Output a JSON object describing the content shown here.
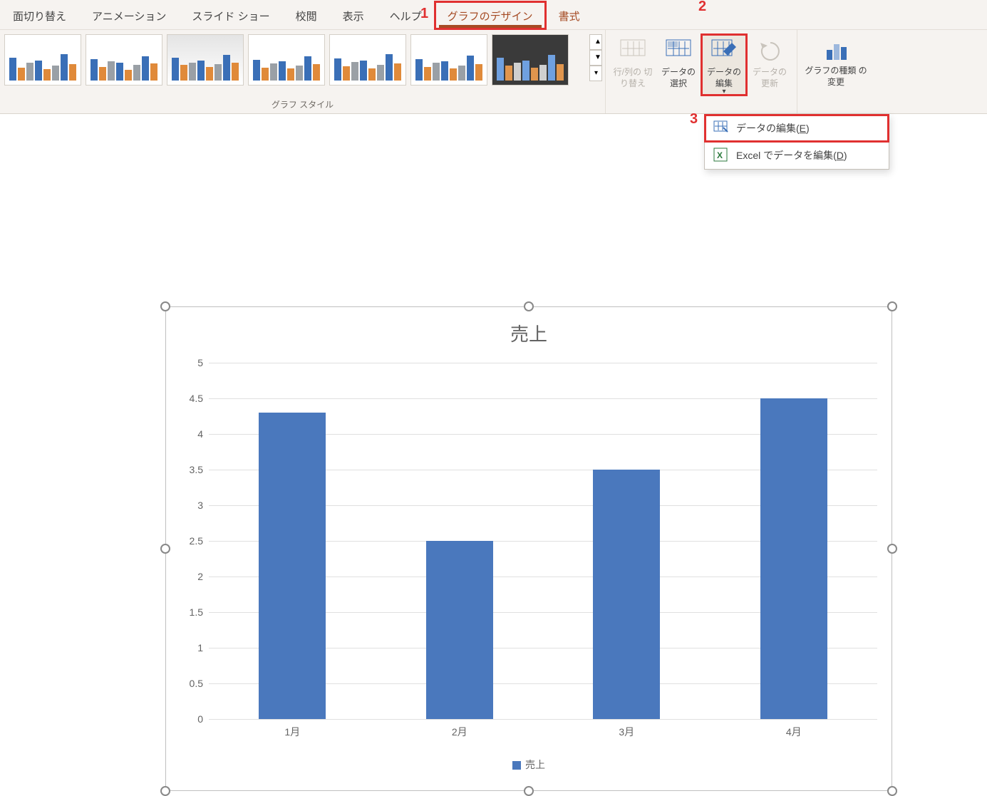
{
  "tabs": {
    "transition": "面切り替え",
    "animation": "アニメーション",
    "slideshow": "スライド ショー",
    "review": "校閲",
    "view": "表示",
    "help": "ヘルプ",
    "chart_design": "グラフのデザイン",
    "format": "書式"
  },
  "ribbon": {
    "styles_label": "グラフ スタイル",
    "switch_rowcol": "行/列の\n切り替え",
    "select_data": "データの\n選択",
    "edit_data": "データの\n編集",
    "refresh_data": "データの\n更新",
    "change_chart_type": "グラフの種類\nの変更"
  },
  "dropdown": {
    "edit_data": "データの編集",
    "edit_data_key": "E",
    "edit_in_excel": "Excel でデータを編集",
    "edit_in_excel_key": "D"
  },
  "callouts": {
    "c1": "1",
    "c2": "2",
    "c3": "3"
  },
  "chart_data": {
    "type": "bar",
    "title": "売上",
    "ylabel": "",
    "xlabel": "",
    "ylim": [
      0,
      5
    ],
    "ystep": 0.5,
    "categories": [
      "1月",
      "2月",
      "3月",
      "4月"
    ],
    "series": [
      {
        "name": "売上",
        "values": [
          4.3,
          2.5,
          3.5,
          4.5
        ],
        "color": "#4a78bd"
      }
    ],
    "y_ticks": [
      "0",
      "0.5",
      "1",
      "1.5",
      "2",
      "2.5",
      "3",
      "3.5",
      "4",
      "4.5",
      "5"
    ]
  }
}
